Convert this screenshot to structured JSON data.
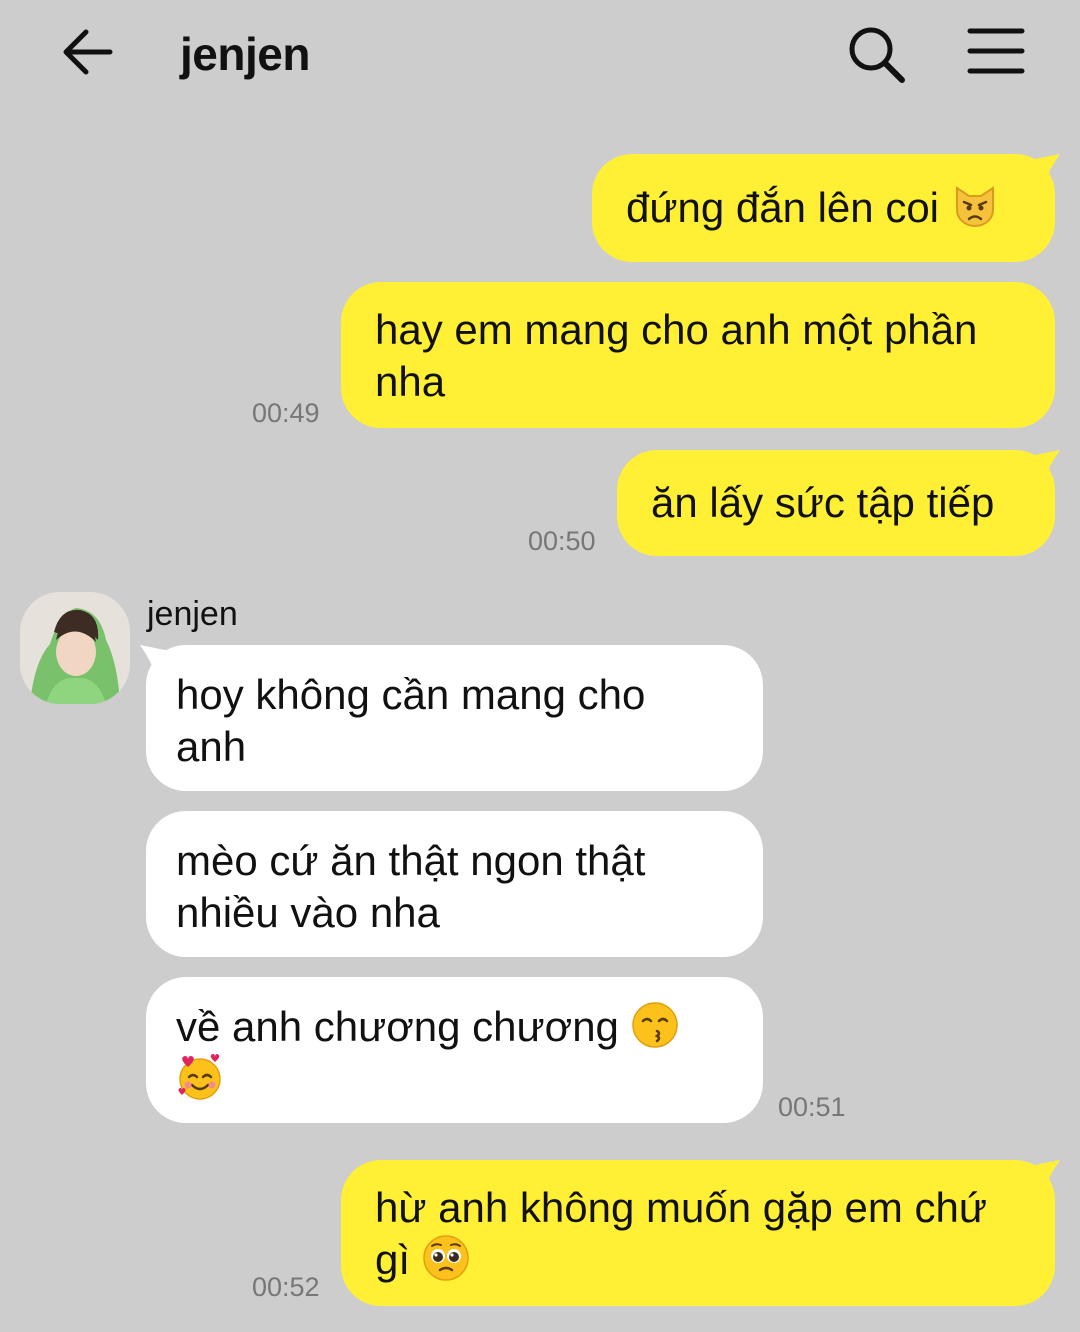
{
  "header": {
    "title": "jenjen",
    "back_icon": "arrow-left-icon",
    "search_icon": "search-icon",
    "menu_icon": "hamburger-menu-icon"
  },
  "messages": [
    {
      "dir": "out",
      "text": "đứng đắn lên coi",
      "emoji": "pouting-cat-face"
    },
    {
      "dir": "out",
      "line1": "hay em mang cho anh một phần",
      "line2": "nha",
      "time": "00:49"
    },
    {
      "dir": "out",
      "text": "ăn lấy sức tập tiếp",
      "time": "00:50"
    },
    {
      "dir": "in",
      "sender": "jenjen",
      "line1": "hoy không cần mang cho",
      "line2": "anh"
    },
    {
      "dir": "in",
      "line1": "mèo cứ ăn thật ngon thật",
      "line2": "nhiều vào nha"
    },
    {
      "dir": "in",
      "text": "về anh chương chương",
      "emoji1": "kissing-face",
      "emoji2": "smiling-face-with-hearts",
      "time": "00:51"
    },
    {
      "dir": "out",
      "line1": "hừ anh không muốn gặp em chứ",
      "line2": "gì",
      "emoji": "pleading-face",
      "time": "00:52"
    }
  ],
  "colors": {
    "background": "#cdcdcd",
    "outgoing_bubble": "#fff035",
    "incoming_bubble": "#ffffff",
    "timestamp": "#777777"
  }
}
